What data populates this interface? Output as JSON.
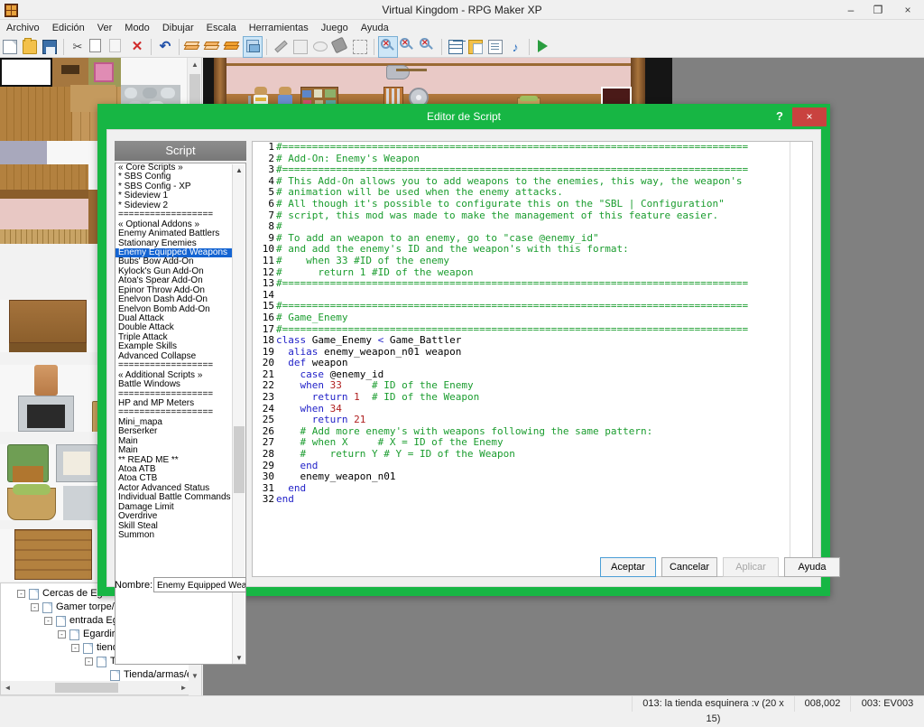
{
  "window": {
    "title": "Virtual Kingdom - RPG Maker XP",
    "minimize": "–",
    "maximize": "❐",
    "close": "×"
  },
  "menu": {
    "items": [
      {
        "label": "Archivo"
      },
      {
        "label": "Edición"
      },
      {
        "label": "Ver"
      },
      {
        "label": "Modo"
      },
      {
        "label": "Dibujar"
      },
      {
        "label": "Escala"
      },
      {
        "label": "Herramientas"
      },
      {
        "label": "Juego"
      },
      {
        "label": "Ayuda"
      }
    ]
  },
  "toolbar": {
    "items": [
      {
        "name": "new-icon"
      },
      {
        "name": "open-icon"
      },
      {
        "name": "save-icon"
      },
      {
        "name": "separator"
      },
      {
        "name": "cut-icon"
      },
      {
        "name": "copy-icon"
      },
      {
        "name": "paste-icon"
      },
      {
        "name": "delete-icon"
      },
      {
        "name": "separator"
      },
      {
        "name": "undo-icon"
      },
      {
        "name": "separator"
      },
      {
        "name": "layer1-icon"
      },
      {
        "name": "layer2-icon"
      },
      {
        "name": "layer3-icon"
      },
      {
        "name": "event-layer-icon"
      },
      {
        "name": "separator"
      },
      {
        "name": "pencil-icon"
      },
      {
        "name": "rectangle-icon"
      },
      {
        "name": "ellipse-icon"
      },
      {
        "name": "fill-icon"
      },
      {
        "name": "select-icon"
      },
      {
        "name": "separator"
      },
      {
        "name": "zoom-1-1-icon"
      },
      {
        "name": "zoom-1-2-icon"
      },
      {
        "name": "zoom-1-4-icon"
      },
      {
        "name": "separator"
      },
      {
        "name": "database-icon"
      },
      {
        "name": "materials-icon"
      },
      {
        "name": "script-editor-icon"
      },
      {
        "name": "sound-test-icon"
      },
      {
        "name": "separator"
      },
      {
        "name": "playtest-icon"
      }
    ]
  },
  "maptree": {
    "nodes": [
      {
        "label": "Cercas de Egardir",
        "depth": 0,
        "toggle": "-"
      },
      {
        "label": "Gamer torpe/ aparición",
        "depth": 1,
        "toggle": "-"
      },
      {
        "label": "entrada Egardir",
        "depth": 2,
        "toggle": "-"
      },
      {
        "label": "Egardir",
        "depth": 3,
        "toggle": "-"
      },
      {
        "label": "tienda limor",
        "depth": 4,
        "toggle": "-"
      },
      {
        "label": "Tienda limor arriba",
        "depth": 5,
        "toggle": "-"
      },
      {
        "label": "Tienda/armas/es",
        "depth": 6,
        "toggle": ""
      }
    ]
  },
  "statusbar": {
    "map": "013: la tienda esquinera :v (20 x 15)",
    "coords": "008,002",
    "event": "003: EV003"
  },
  "dialog": {
    "title": "Editor de Script",
    "help_label": "?",
    "close_label": "×",
    "script_header": "Script",
    "name_label": "Nombre:",
    "name_value": "Enemy Equipped Weapons",
    "buttons": [
      {
        "label": "Aceptar",
        "state": "primary"
      },
      {
        "label": "Cancelar",
        "state": "normal"
      },
      {
        "label": "Aplicar",
        "state": "disabled"
      },
      {
        "label": "Ayuda",
        "state": "normal"
      }
    ],
    "scripts": [
      {
        "label": "« Core Scripts »",
        "selected": false
      },
      {
        "label": "* SBS Config",
        "selected": false
      },
      {
        "label": "* SBS Config - XP",
        "selected": false
      },
      {
        "label": "* Sideview 1",
        "selected": false
      },
      {
        "label": "* Sideview 2",
        "selected": false
      },
      {
        "label": "==================",
        "selected": false
      },
      {
        "label": "« Optional Addons »",
        "selected": false
      },
      {
        "label": "Enemy Animated Battlers",
        "selected": false
      },
      {
        "label": "Stationary Enemies",
        "selected": false
      },
      {
        "label": "Enemy Equipped Weapons",
        "selected": true
      },
      {
        "label": "Bubs' Bow Add-On",
        "selected": false
      },
      {
        "label": "Kylock's Gun Add-On",
        "selected": false
      },
      {
        "label": "Atoa's Spear Add-On",
        "selected": false
      },
      {
        "label": "Epinor Throw Add-On",
        "selected": false
      },
      {
        "label": "Enelvon Dash Add-On",
        "selected": false
      },
      {
        "label": "Enelvon Bomb Add-On",
        "selected": false
      },
      {
        "label": "Dual Attack",
        "selected": false
      },
      {
        "label": "Double Attack",
        "selected": false
      },
      {
        "label": "Triple Attack",
        "selected": false
      },
      {
        "label": "Example Skills",
        "selected": false
      },
      {
        "label": "Advanced Collapse",
        "selected": false
      },
      {
        "label": "==================",
        "selected": false
      },
      {
        "label": "« Additional Scripts »",
        "selected": false
      },
      {
        "label": "Battle Windows",
        "selected": false
      },
      {
        "label": "==================",
        "selected": false
      },
      {
        "label": "HP and MP Meters",
        "selected": false
      },
      {
        "label": "==================",
        "selected": false
      },
      {
        "label": "Mini_mapa",
        "selected": false
      },
      {
        "label": "Berserker",
        "selected": false
      },
      {
        "label": "Main",
        "selected": false
      },
      {
        "label": "Main",
        "selected": false
      },
      {
        "label": "** READ ME **",
        "selected": false
      },
      {
        "label": "Atoa ATB",
        "selected": false
      },
      {
        "label": "Atoa CTB",
        "selected": false
      },
      {
        "label": "Actor Advanced Status",
        "selected": false
      },
      {
        "label": "Individual Battle Commands",
        "selected": false
      },
      {
        "label": "Damage Limit",
        "selected": false
      },
      {
        "label": "Overdrive",
        "selected": false
      },
      {
        "label": "Skill Steal",
        "selected": false
      },
      {
        "label": "Summon",
        "selected": false
      }
    ],
    "code_lines": [
      {
        "n": "1",
        "spans": [
          {
            "t": "#==============================================================================",
            "c": "cm"
          }
        ]
      },
      {
        "n": "2",
        "spans": [
          {
            "t": "# Add-On: Enemy's Weapon",
            "c": "cm"
          }
        ]
      },
      {
        "n": "3",
        "spans": [
          {
            "t": "#==============================================================================",
            "c": "cm"
          }
        ]
      },
      {
        "n": "4",
        "spans": [
          {
            "t": "# This Add-On allows you to add weapons to the enemies, this way, the weapon's",
            "c": "cm"
          }
        ]
      },
      {
        "n": "5",
        "spans": [
          {
            "t": "# animation will be used when the enemy attacks.",
            "c": "cm"
          }
        ]
      },
      {
        "n": "6",
        "spans": [
          {
            "t": "# All though it's possible to configurate this on the \"SBL | Configuration\"",
            "c": "cm"
          }
        ]
      },
      {
        "n": "7",
        "spans": [
          {
            "t": "# script, this mod was made to make the management of this feature easier.",
            "c": "cm"
          }
        ]
      },
      {
        "n": "8",
        "spans": [
          {
            "t": "#",
            "c": "cm"
          }
        ]
      },
      {
        "n": "9",
        "spans": [
          {
            "t": "# To add an weapon to an enemy, go to \"case @enemy_id\"",
            "c": "cm"
          }
        ]
      },
      {
        "n": "10",
        "spans": [
          {
            "t": "# and add the enemy's ID and the weapon's with this format:",
            "c": "cm"
          }
        ]
      },
      {
        "n": "11",
        "spans": [
          {
            "t": "#    when 33 #ID of the enemy",
            "c": "cm"
          }
        ]
      },
      {
        "n": "12",
        "spans": [
          {
            "t": "#      return 1 #ID of the weapon",
            "c": "cm"
          }
        ]
      },
      {
        "n": "13",
        "spans": [
          {
            "t": "#==============================================================================",
            "c": "cm"
          }
        ]
      },
      {
        "n": "14",
        "spans": [
          {
            "t": "",
            "c": "cls"
          }
        ]
      },
      {
        "n": "15",
        "spans": [
          {
            "t": "#==============================================================================",
            "c": "cm"
          }
        ]
      },
      {
        "n": "16",
        "spans": [
          {
            "t": "# Game_Enemy",
            "c": "cm"
          }
        ]
      },
      {
        "n": "17",
        "spans": [
          {
            "t": "#==============================================================================",
            "c": "cm"
          }
        ]
      },
      {
        "n": "18",
        "spans": [
          {
            "t": "class",
            "c": "kw"
          },
          {
            "t": " Game_Enemy ",
            "c": "cls"
          },
          {
            "t": "<",
            "c": "kw"
          },
          {
            "t": " Game_Battler",
            "c": "cls"
          }
        ]
      },
      {
        "n": "19",
        "spans": [
          {
            "t": "  ",
            "c": "cls"
          },
          {
            "t": "alias",
            "c": "kw"
          },
          {
            "t": " enemy_weapon_n01 weapon",
            "c": "cls"
          }
        ]
      },
      {
        "n": "20",
        "spans": [
          {
            "t": "  ",
            "c": "cls"
          },
          {
            "t": "def",
            "c": "kw"
          },
          {
            "t": " weapon",
            "c": "cls"
          }
        ]
      },
      {
        "n": "21",
        "spans": [
          {
            "t": "    ",
            "c": "cls"
          },
          {
            "t": "case",
            "c": "kw"
          },
          {
            "t": " @enemy_id",
            "c": "cls"
          }
        ]
      },
      {
        "n": "22",
        "spans": [
          {
            "t": "    ",
            "c": "cls"
          },
          {
            "t": "when",
            "c": "kw"
          },
          {
            "t": " ",
            "c": "cls"
          },
          {
            "t": "33",
            "c": "num"
          },
          {
            "t": "     ",
            "c": "cls"
          },
          {
            "t": "# ID of the Enemy",
            "c": "cm"
          }
        ]
      },
      {
        "n": "23",
        "spans": [
          {
            "t": "      ",
            "c": "cls"
          },
          {
            "t": "return",
            "c": "kw"
          },
          {
            "t": " ",
            "c": "cls"
          },
          {
            "t": "1",
            "c": "num"
          },
          {
            "t": "  ",
            "c": "cls"
          },
          {
            "t": "# ID of the Weapon",
            "c": "cm"
          }
        ]
      },
      {
        "n": "24",
        "spans": [
          {
            "t": "    ",
            "c": "cls"
          },
          {
            "t": "when",
            "c": "kw"
          },
          {
            "t": " ",
            "c": "cls"
          },
          {
            "t": "34",
            "c": "num"
          }
        ]
      },
      {
        "n": "25",
        "spans": [
          {
            "t": "      ",
            "c": "cls"
          },
          {
            "t": "return",
            "c": "kw"
          },
          {
            "t": " ",
            "c": "cls"
          },
          {
            "t": "21",
            "c": "num"
          }
        ]
      },
      {
        "n": "26",
        "spans": [
          {
            "t": "    # Add more enemy's with weapons following the same pattern:",
            "c": "cm"
          }
        ]
      },
      {
        "n": "27",
        "spans": [
          {
            "t": "    # when X     # X = ID of the Enemy",
            "c": "cm"
          }
        ]
      },
      {
        "n": "28",
        "spans": [
          {
            "t": "    #    return Y # Y = ID of the Weapon",
            "c": "cm"
          }
        ]
      },
      {
        "n": "29",
        "spans": [
          {
            "t": "    ",
            "c": "cls"
          },
          {
            "t": "end",
            "c": "kw"
          }
        ]
      },
      {
        "n": "30",
        "spans": [
          {
            "t": "    enemy_weapon_n01",
            "c": "cls"
          }
        ]
      },
      {
        "n": "31",
        "spans": [
          {
            "t": "  ",
            "c": "cls"
          },
          {
            "t": "end",
            "c": "kw"
          }
        ]
      },
      {
        "n": "32",
        "spans": [
          {
            "t": "end",
            "c": "kw"
          }
        ]
      }
    ]
  },
  "colors": {
    "dialog_accent": "#17b644",
    "selection": "#1464d2",
    "comment": "#1a9c2e",
    "keyword": "#2222c8",
    "number": "#b02020",
    "close_button": "#c9423f"
  }
}
